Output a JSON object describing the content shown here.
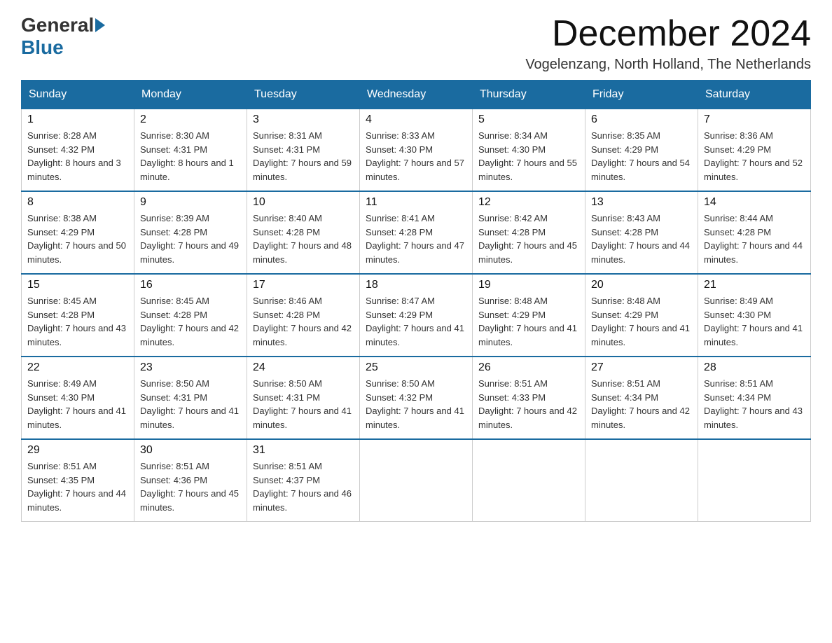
{
  "header": {
    "logo_general": "General",
    "logo_blue": "Blue",
    "month_title": "December 2024",
    "location": "Vogelenzang, North Holland, The Netherlands"
  },
  "weekdays": [
    "Sunday",
    "Monday",
    "Tuesday",
    "Wednesday",
    "Thursday",
    "Friday",
    "Saturday"
  ],
  "weeks": [
    [
      {
        "day": "1",
        "sunrise": "8:28 AM",
        "sunset": "4:32 PM",
        "daylight": "8 hours and 3 minutes."
      },
      {
        "day": "2",
        "sunrise": "8:30 AM",
        "sunset": "4:31 PM",
        "daylight": "8 hours and 1 minute."
      },
      {
        "day": "3",
        "sunrise": "8:31 AM",
        "sunset": "4:31 PM",
        "daylight": "7 hours and 59 minutes."
      },
      {
        "day": "4",
        "sunrise": "8:33 AM",
        "sunset": "4:30 PM",
        "daylight": "7 hours and 57 minutes."
      },
      {
        "day": "5",
        "sunrise": "8:34 AM",
        "sunset": "4:30 PM",
        "daylight": "7 hours and 55 minutes."
      },
      {
        "day": "6",
        "sunrise": "8:35 AM",
        "sunset": "4:29 PM",
        "daylight": "7 hours and 54 minutes."
      },
      {
        "day": "7",
        "sunrise": "8:36 AM",
        "sunset": "4:29 PM",
        "daylight": "7 hours and 52 minutes."
      }
    ],
    [
      {
        "day": "8",
        "sunrise": "8:38 AM",
        "sunset": "4:29 PM",
        "daylight": "7 hours and 50 minutes."
      },
      {
        "day": "9",
        "sunrise": "8:39 AM",
        "sunset": "4:28 PM",
        "daylight": "7 hours and 49 minutes."
      },
      {
        "day": "10",
        "sunrise": "8:40 AM",
        "sunset": "4:28 PM",
        "daylight": "7 hours and 48 minutes."
      },
      {
        "day": "11",
        "sunrise": "8:41 AM",
        "sunset": "4:28 PM",
        "daylight": "7 hours and 47 minutes."
      },
      {
        "day": "12",
        "sunrise": "8:42 AM",
        "sunset": "4:28 PM",
        "daylight": "7 hours and 45 minutes."
      },
      {
        "day": "13",
        "sunrise": "8:43 AM",
        "sunset": "4:28 PM",
        "daylight": "7 hours and 44 minutes."
      },
      {
        "day": "14",
        "sunrise": "8:44 AM",
        "sunset": "4:28 PM",
        "daylight": "7 hours and 44 minutes."
      }
    ],
    [
      {
        "day": "15",
        "sunrise": "8:45 AM",
        "sunset": "4:28 PM",
        "daylight": "7 hours and 43 minutes."
      },
      {
        "day": "16",
        "sunrise": "8:45 AM",
        "sunset": "4:28 PM",
        "daylight": "7 hours and 42 minutes."
      },
      {
        "day": "17",
        "sunrise": "8:46 AM",
        "sunset": "4:28 PM",
        "daylight": "7 hours and 42 minutes."
      },
      {
        "day": "18",
        "sunrise": "8:47 AM",
        "sunset": "4:29 PM",
        "daylight": "7 hours and 41 minutes."
      },
      {
        "day": "19",
        "sunrise": "8:48 AM",
        "sunset": "4:29 PM",
        "daylight": "7 hours and 41 minutes."
      },
      {
        "day": "20",
        "sunrise": "8:48 AM",
        "sunset": "4:29 PM",
        "daylight": "7 hours and 41 minutes."
      },
      {
        "day": "21",
        "sunrise": "8:49 AM",
        "sunset": "4:30 PM",
        "daylight": "7 hours and 41 minutes."
      }
    ],
    [
      {
        "day": "22",
        "sunrise": "8:49 AM",
        "sunset": "4:30 PM",
        "daylight": "7 hours and 41 minutes."
      },
      {
        "day": "23",
        "sunrise": "8:50 AM",
        "sunset": "4:31 PM",
        "daylight": "7 hours and 41 minutes."
      },
      {
        "day": "24",
        "sunrise": "8:50 AM",
        "sunset": "4:31 PM",
        "daylight": "7 hours and 41 minutes."
      },
      {
        "day": "25",
        "sunrise": "8:50 AM",
        "sunset": "4:32 PM",
        "daylight": "7 hours and 41 minutes."
      },
      {
        "day": "26",
        "sunrise": "8:51 AM",
        "sunset": "4:33 PM",
        "daylight": "7 hours and 42 minutes."
      },
      {
        "day": "27",
        "sunrise": "8:51 AM",
        "sunset": "4:34 PM",
        "daylight": "7 hours and 42 minutes."
      },
      {
        "day": "28",
        "sunrise": "8:51 AM",
        "sunset": "4:34 PM",
        "daylight": "7 hours and 43 minutes."
      }
    ],
    [
      {
        "day": "29",
        "sunrise": "8:51 AM",
        "sunset": "4:35 PM",
        "daylight": "7 hours and 44 minutes."
      },
      {
        "day": "30",
        "sunrise": "8:51 AM",
        "sunset": "4:36 PM",
        "daylight": "7 hours and 45 minutes."
      },
      {
        "day": "31",
        "sunrise": "8:51 AM",
        "sunset": "4:37 PM",
        "daylight": "7 hours and 46 minutes."
      },
      null,
      null,
      null,
      null
    ]
  ]
}
